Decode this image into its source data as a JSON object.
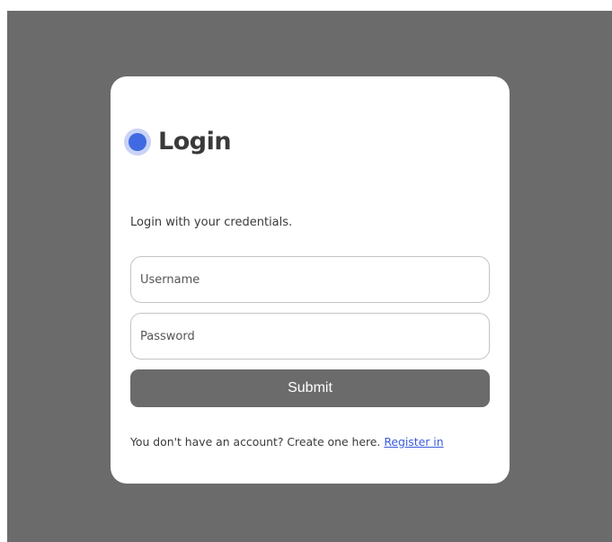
{
  "login": {
    "title": "Login",
    "subtitle": "Login with your credentials.",
    "username_placeholder": "Username",
    "password_placeholder": "Password",
    "submit_label": "Submit",
    "footer_text": "You don't have an account? Create one here. ",
    "register_link": "Register in"
  },
  "colors": {
    "background": "#6b6b6b",
    "card": "#ffffff",
    "accent": "#4169e1",
    "button": "#6b6b6b",
    "link": "#3b5bdb"
  },
  "icons": {
    "title_icon": "blue-dot-icon"
  }
}
